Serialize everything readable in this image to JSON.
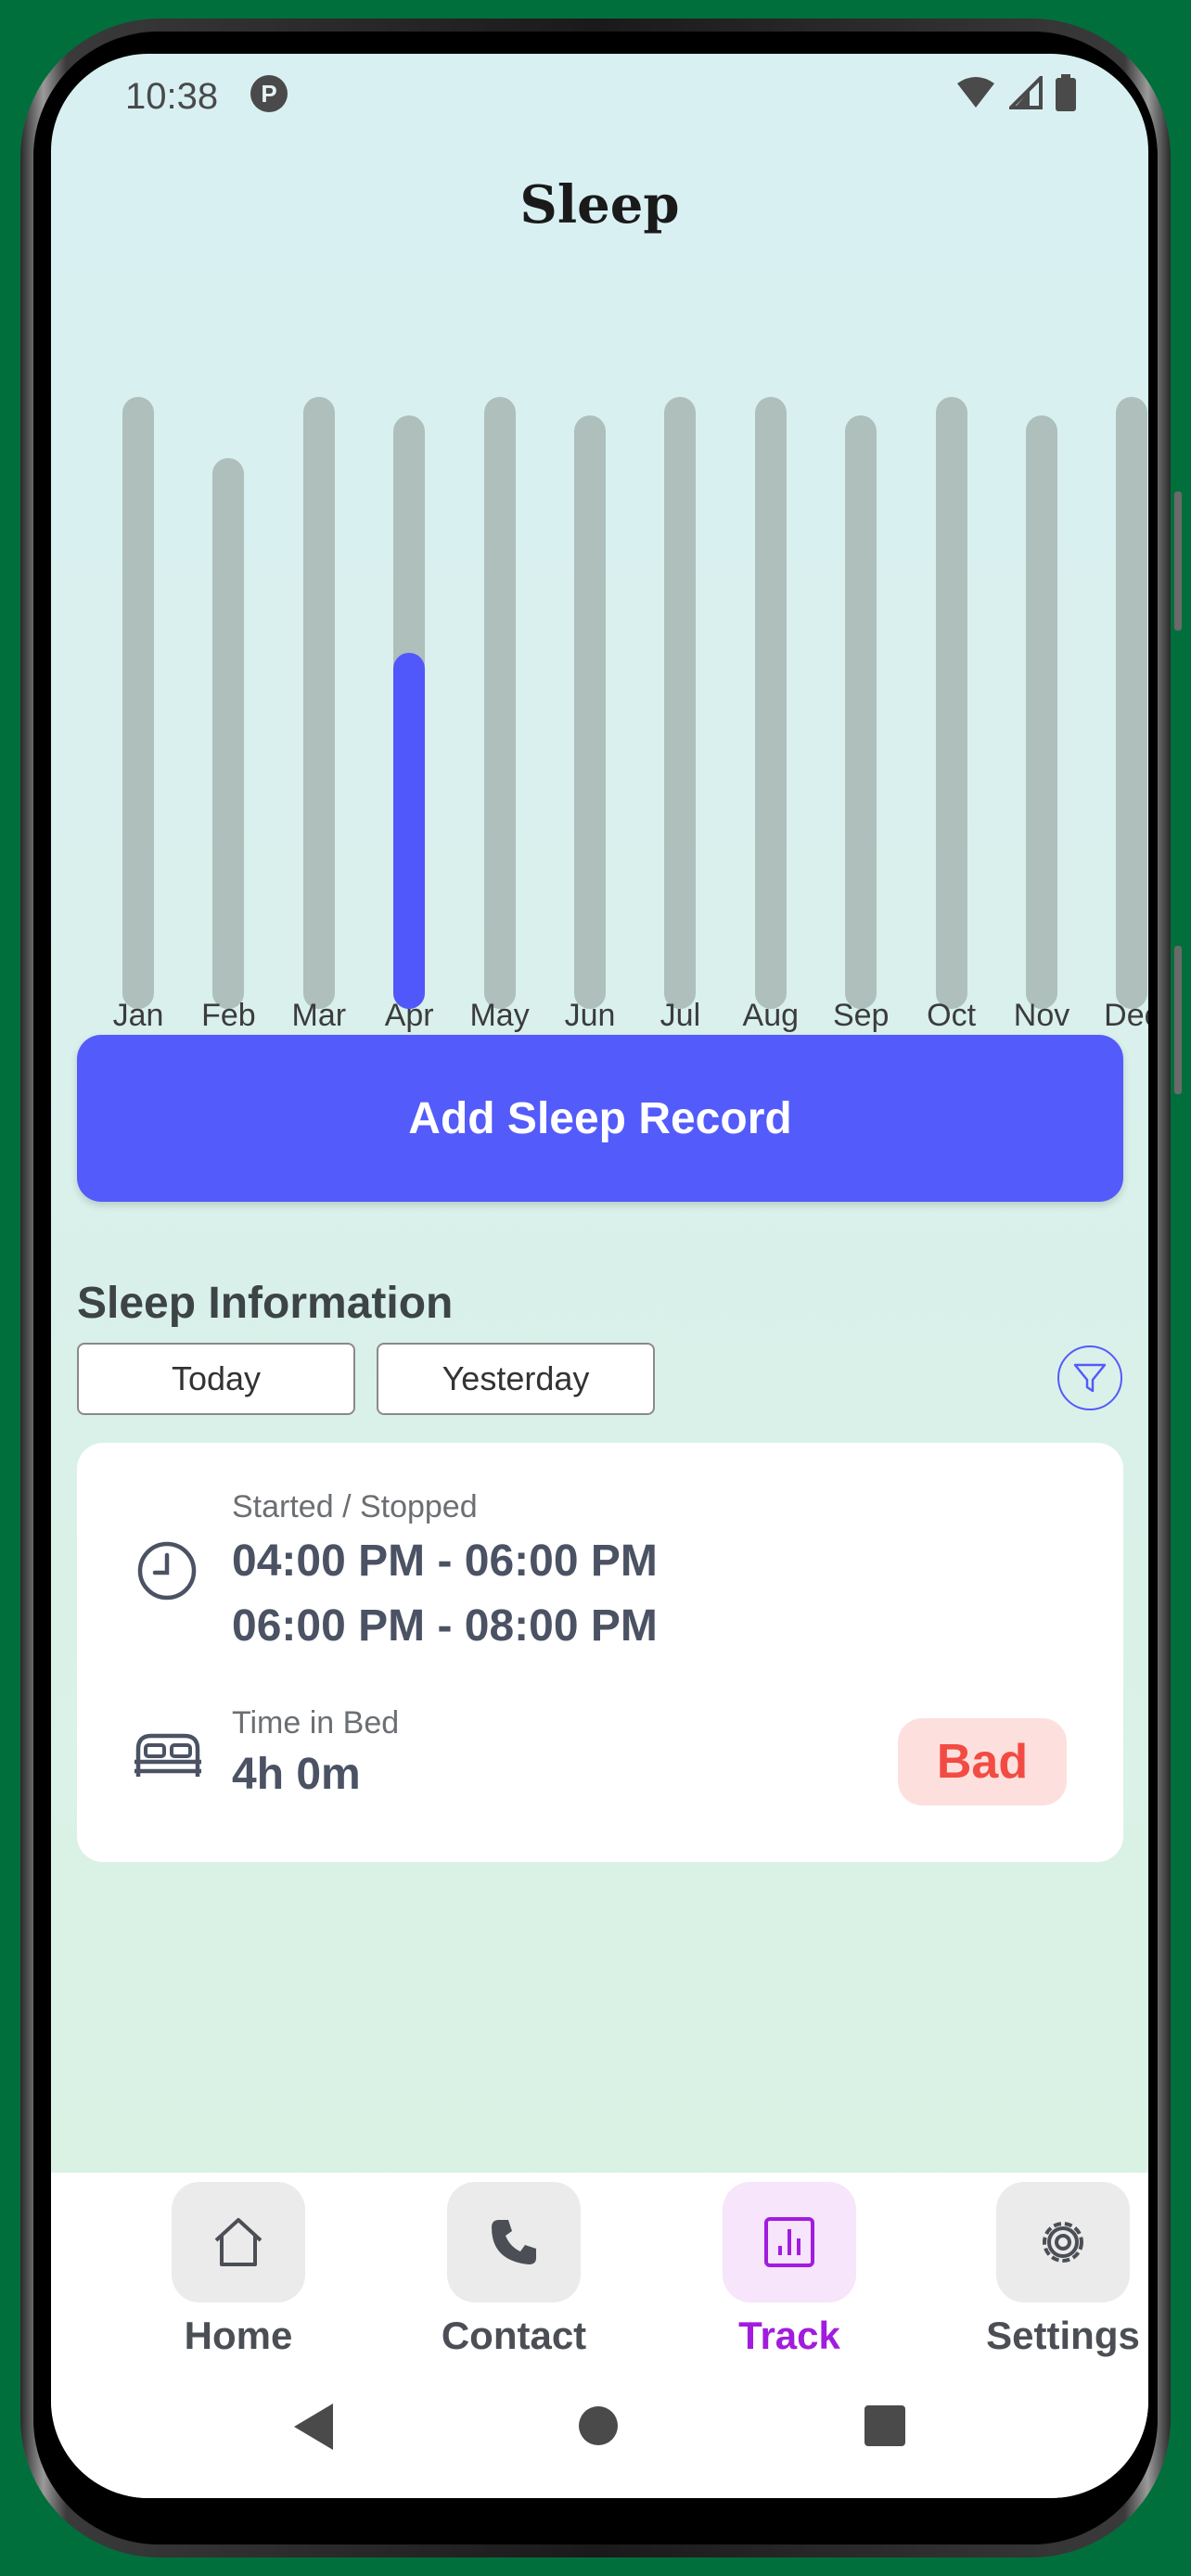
{
  "status": {
    "time": "10:38",
    "app_icon_glyph": "P"
  },
  "page": {
    "title": "Sleep"
  },
  "chart_data": {
    "type": "bar",
    "categories": [
      "Jan",
      "Feb",
      "Mar",
      "Apr",
      "May",
      "Jun",
      "Jul",
      "Aug",
      "Sep",
      "Oct",
      "Nov",
      "Dec"
    ],
    "track_levels": [
      1.0,
      0.9,
      1.0,
      0.97,
      1.0,
      0.97,
      1.0,
      1.0,
      0.97,
      1.0,
      0.97,
      1.0
    ],
    "highlighted_category": "Apr",
    "highlighted_level": 0.6,
    "colors": {
      "track": "#aebfbc",
      "highlight": "#5057fb"
    }
  },
  "actions": {
    "add_record_label": "Add Sleep Record"
  },
  "sleep_info": {
    "section_title": "Sleep Information",
    "filters": [
      "Today",
      "Yesterday"
    ],
    "started_stopped_label": "Started / Stopped",
    "time_ranges": [
      "04:00 PM - 06:00 PM",
      "06:00 PM - 08:00 PM"
    ],
    "time_in_bed_label": "Time in Bed",
    "time_in_bed_value": "4h 0m",
    "quality_badge": "Bad"
  },
  "bottom_nav": {
    "items": [
      {
        "label": "Home",
        "icon": "home-icon"
      },
      {
        "label": "Contact",
        "icon": "phone-icon"
      },
      {
        "label": "Track",
        "icon": "chart-icon",
        "active": true
      },
      {
        "label": "Settings",
        "icon": "gear-icon"
      }
    ]
  },
  "colors": {
    "accent": "#535bfb",
    "active_nav": "#a21cde",
    "bad": "#f24b43"
  }
}
